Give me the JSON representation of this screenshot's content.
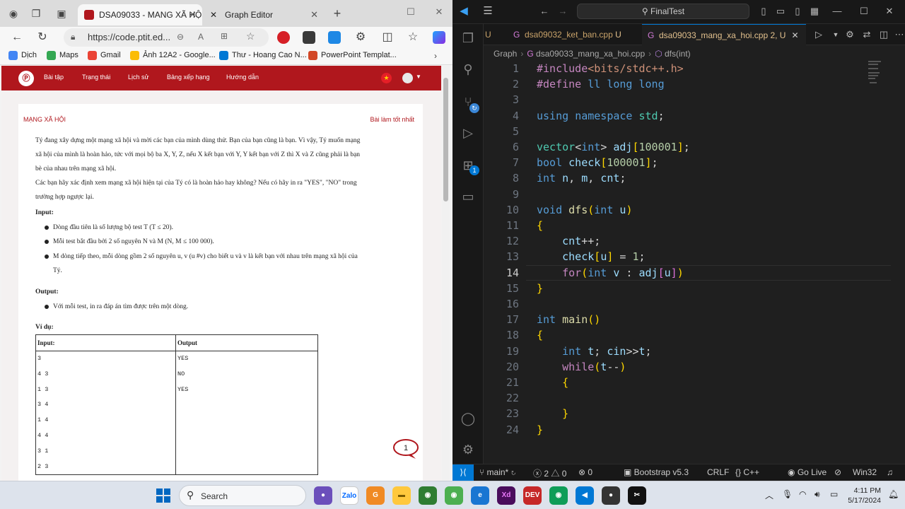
{
  "browser": {
    "tabs": [
      {
        "label": "DSA09033 - MANG XÃ HỘI",
        "active": true
      },
      {
        "label": "Graph Editor",
        "active": false
      }
    ],
    "url": "https://code.ptit.ed...",
    "bookmarks": [
      "Dịch",
      "Maps",
      "Gmail",
      "Ảnh 12A2 - Google...",
      "Thư - Hoang Cao N...",
      "PowerPoint Templat..."
    ]
  },
  "site": {
    "nav": [
      "Bài tập",
      "Trạng thái",
      "Lịch sử",
      "Bảng xếp hạng",
      "Hướng dẫn"
    ],
    "problem_title": "MẠNG XÃ HỘI",
    "best_solutions": "Bài làm tốt nhất",
    "statement": [
      "Tý đang xây dựng một mạng xã hội và mời các bạn của mình dùng thử. Bạn của bạn cũng là bạn. Vì vậy, Tý muốn mạng",
      "xã hội của mình là hoàn hảo, tức với mọi bộ ba X, Y, Z, nếu X kết bạn với Y, Y kết bạn với Z thì X và Z cũng phải là bạn",
      "bè của nhau trên mạng xã hội.",
      "Các bạn hãy xác định xem mạng xã hội hiện tại của Tý có là hoàn hảo hay không? Nếu có hãy in ra \"YES\", \"NO\" trong",
      "trường hợp ngược lại."
    ],
    "input_heading": "Input:",
    "input_items": [
      "Dòng đầu tiên là số lượng bộ test T (T ≤ 20).",
      "Mỗi test bắt đầu bởi 2 số nguyên N và M (N, M ≤ 100 000).",
      "M dòng tiếp theo, mỗi dòng gồm 2 số nguyên u, v (u #v) cho biết u và v là kết bạn với nhau trên mạng xã hội của",
      "Tý."
    ],
    "output_heading": "Output:",
    "output_items": [
      "Với mỗi test, in ra đáp án tìm được trên một dòng."
    ],
    "example_heading": "Ví dụ:",
    "example": {
      "headers": [
        "Input:",
        "Output"
      ],
      "input_lines": [
        "3",
        "4  3",
        "1  3",
        "3  4",
        "1  4",
        "4  4",
        "3  1",
        "2  3"
      ],
      "output_lines": [
        "YES",
        "NO",
        "YES",
        "",
        "",
        "",
        "",
        ""
      ]
    },
    "chat_badge": "1"
  },
  "vscode": {
    "search": "FinalTest",
    "tabs": [
      {
        "label": "U",
        "active": false
      },
      {
        "label": "dsa09032_ket_ban.cpp",
        "suffix": "U",
        "active": false
      },
      {
        "label": "dsa09033_mang_xa_hoi.cpp",
        "suffix": "2, U",
        "active": true
      }
    ],
    "breadcrumb": [
      "Graph",
      "dsa09033_mang_xa_hoi.cpp",
      "dfs(int)"
    ],
    "current_line": 14,
    "explorer_badge": "1",
    "status": {
      "branch": "main*",
      "errors": "2",
      "warnings": "0",
      "ports": "0",
      "bootstrap": "Bootstrap v5.3",
      "eol": "CRLF",
      "lang": "C++",
      "golive": "Go Live",
      "platform": "Win32"
    }
  },
  "code_lines": [
    "#include<bits/stdc++.h>",
    "#define ll long long",
    "",
    "using namespace std;",
    "",
    "vector<int> adj[100001];",
    "bool check[100001];",
    "int n, m, cnt;",
    "",
    "void dfs(int u)",
    "{",
    "    cnt++;",
    "    check[u] = 1;",
    "    for(int v : adj[u])",
    "}",
    "",
    "int main()",
    "{",
    "    int t; cin>>t;",
    "    while(t--)",
    "    {",
    "",
    "    }",
    "}"
  ],
  "taskbar": {
    "search": "Search",
    "time": "4:11 PM",
    "date": "5/17/2024"
  }
}
